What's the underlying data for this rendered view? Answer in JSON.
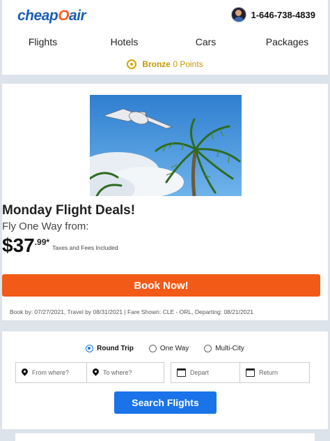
{
  "header": {
    "logo": {
      "pre": "cheap",
      "o": "O",
      "post": "air"
    },
    "phone": "1-646-738-4839",
    "nav": [
      "Flights",
      "Hotels",
      "Cars",
      "Packages"
    ],
    "tier": "Bronze",
    "points": "0 Points"
  },
  "deal": {
    "title": "Monday Flight Deals!",
    "subtitle": "Fly One Way from:",
    "price_main": "$37",
    "price_cents": ".99*",
    "tax_note": "Taxes and Fees Included",
    "book_label": "Book Now!",
    "fine_print": "Book by: 07/27/2021, Travel by 08/31/2021 | Fare Shown: CLE - ORL, Departing: 08/21/2021"
  },
  "search": {
    "trip_types": [
      "Round Trip",
      "One Way",
      "Multi-City"
    ],
    "selected_trip": "Round Trip",
    "from_placeholder": "From where?",
    "to_placeholder": "To where?",
    "depart_placeholder": "Depart",
    "return_placeholder": "Return",
    "search_label": "Search Flights"
  },
  "colors": {
    "brand_blue": "#1a5fb4",
    "accent_orange": "#f25a17",
    "button_blue": "#1a73e8",
    "bronze": "#c99700"
  }
}
